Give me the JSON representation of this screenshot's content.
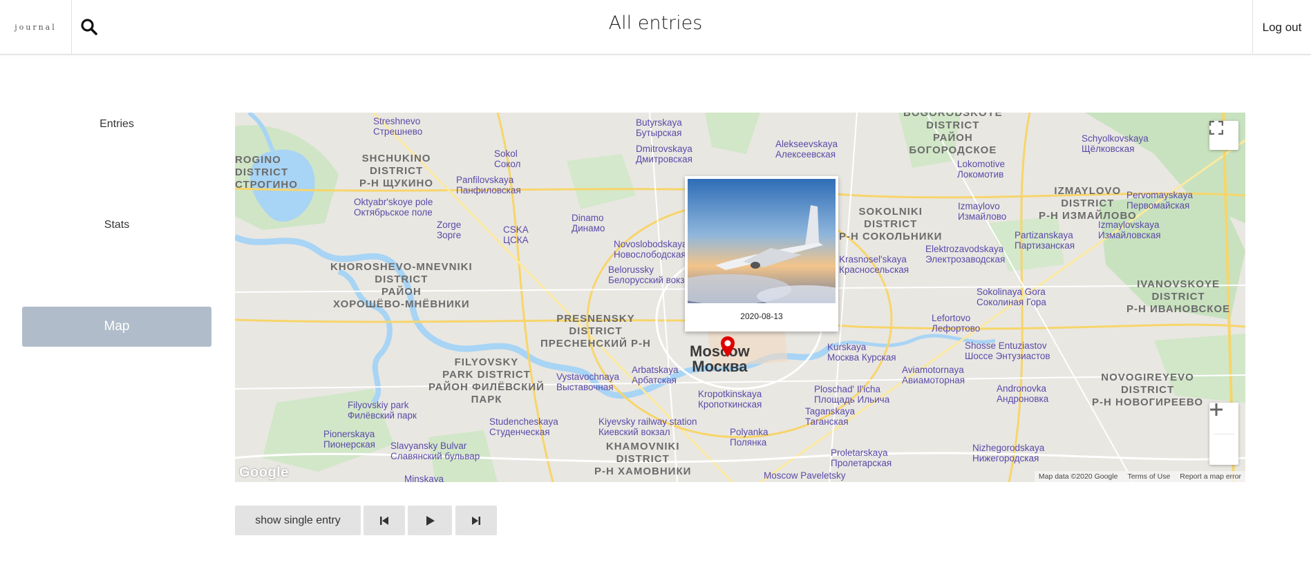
{
  "header": {
    "logo_text": "journal",
    "title": "All entries",
    "logout_label": "Log out"
  },
  "sidebar": {
    "items": [
      {
        "label": "Entries"
      },
      {
        "label": "Stats"
      },
      {
        "label": "Map",
        "active": true
      }
    ],
    "active_color": "#b0bcc9"
  },
  "map": {
    "districts": [
      "ROGINO DISTRICT",
      "SHCHUKINO DISTRICT Р-Н ЩУКИНО",
      "KHOROSHEVO-MNEVNIKI DISTRICT РАЙОН ХОРОШЁВО-МНЁВНИКИ",
      "PRESNENSKY DISTRICT ПРЕСНЕНСКИЙ Р-Н",
      "FILYOVSKY PARK DISTRICT РАЙОН ФИЛЁВСКИЙ ПАРК",
      "KHAMOVNIKI DISTRICT Р-Н ХАМОВНИКИ",
      "SOKOLNIKI DISTRICT Р-Н СОКОЛЬНИКИ",
      "IZMAYLOVO DISTRICT Р-Н ИЗМАЙЛОВО",
      "IVANOVSKOYE DISTRICT Р-Н ИВАНОВСКОЕ",
      "NOVOGIREYEVO DISTRICT Р-Н НОВОГИРЕЕВО",
      "BOGORODSKOYE DISTRICT РАЙОН БОГОРОДСКОЕ"
    ],
    "stations": [
      "Streshnevo Стрешнево",
      "Sokol Сокол",
      "Panfilovskaya Панфиловская",
      "Oktyabr'skoye pole Октябрьское поле",
      "Zorge Зорге",
      "CSKA ЦСКА",
      "Dinamo Динамо",
      "Belorussky Белорусский вокзал",
      "Novoslobodskaya Новослободская",
      "Dmitrovskaya Дмитровская",
      "Butyrskaya Бутырская",
      "Alekseevskaya Алексеевская",
      "Lokomotive Локомотив",
      "Schyolkovskaya Щёлковская",
      "Pervomayskaya Первомайская",
      "Izmaylovo Измайлово",
      "Izmaylovskaya Измайловская",
      "Partizanskaya Партизанская",
      "Elektrozavodskaya Электрозаводская",
      "Krasnosel'skaya Красносельская",
      "Sokolinaya Gora Соколиная Гора",
      "Lefortovo Лефортово",
      "Shosse Entuziastov Шоссе Энтузиастов",
      "Kurskaya Москва Курская",
      "Aviamotornaya Авиамоторная",
      "Andronovka Андроновка",
      "Ploschad' Il'icha Площадь Ильича",
      "Taganskaya Таганская",
      "Proletarskaya Пролетарская",
      "Nizhegorodskaya Нижегородская",
      "Kropotkinskaya Кропоткинская",
      "Polyanka Полянка",
      "Arbatskaya Арбатская",
      "Vystavochnaya Выставочная",
      "Kiyevsky railway station Киевский вокзал",
      "Studencheskaya Студенческая",
      "Slavyansky Bulvar Славянский бульвар",
      "Filyovskiy park Филёвский парк",
      "Pionerskaya Пионерская",
      "Moscow Paveletsky",
      "Minskaya"
    ],
    "city_label_latin": "Moscow",
    "city_label_cyrillic": "Москва",
    "popup_date": "2020-08-13",
    "attribution": {
      "data": "Map data ©2020 Google",
      "terms": "Terms of Use",
      "report": "Report a map error"
    },
    "google_logo": "Google",
    "marker_color": "#e00000"
  },
  "controls": {
    "show_single_label": "show single entry",
    "prev_icon": "skip-back-icon",
    "play_icon": "play-icon",
    "next_icon": "skip-forward-icon"
  }
}
